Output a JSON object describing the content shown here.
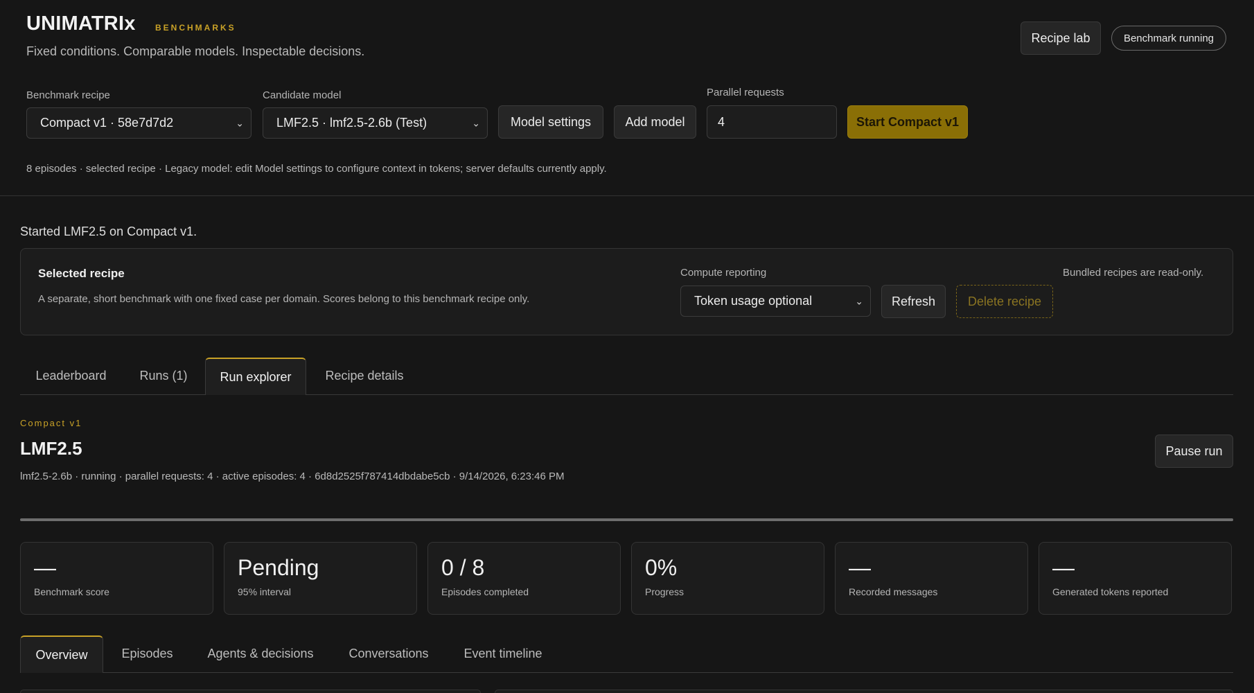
{
  "header": {
    "brand": "UNIMATRIx",
    "brand_tag": "BENCHMARKS",
    "tagline": "Fixed conditions. Comparable models. Inspectable decisions.",
    "recipe_lab_label": "Recipe lab",
    "status_pill": "Benchmark running"
  },
  "controls": {
    "benchmark_recipe_label": "Benchmark recipe",
    "benchmark_recipe_value": "Compact v1 · 58e7d7d2",
    "candidate_model_label": "Candidate model",
    "candidate_model_value": "LMF2.5 · lmf2.5-2.6b (Test)",
    "model_settings_label": "Model settings",
    "add_model_label": "Add model",
    "parallel_requests_label": "Parallel requests",
    "parallel_requests_value": "4",
    "start_label": "Start Compact v1",
    "hint": "8 episodes · selected recipe · Legacy model: edit Model settings to configure context in tokens; server defaults currently apply."
  },
  "status_message": "Started LMF2.5 on Compact v1.",
  "selected_recipe": {
    "title": "Selected recipe",
    "description": "A separate, short benchmark with one fixed case per domain. Scores belong to this benchmark recipe only.",
    "compute_reporting_label": "Compute reporting",
    "compute_reporting_value": "Token usage optional",
    "refresh_label": "Refresh",
    "delete_label": "Delete recipe",
    "readonly_note": "Bundled recipes are read-only."
  },
  "main_tabs": [
    {
      "label": "Leaderboard"
    },
    {
      "label": "Runs (1)"
    },
    {
      "label": "Run explorer",
      "active": true
    },
    {
      "label": "Recipe details"
    }
  ],
  "run": {
    "recipe_tag": "Compact v1",
    "model_title": "LMF2.5",
    "meta": "lmf2.5-2.6b · running · parallel requests: 4 · active episodes: 4 · 6d8d2525f787414dbdabe5cb · 9/14/2026, 6:23:46 PM",
    "pause_label": "Pause run",
    "progress_fraction": 1.0
  },
  "stats": [
    {
      "value": "—",
      "label": "Benchmark score"
    },
    {
      "value": "Pending",
      "label": "95% interval"
    },
    {
      "value": "0 / 8",
      "label": "Episodes completed"
    },
    {
      "value": "0%",
      "label": "Progress"
    },
    {
      "value": "—",
      "label": "Recorded messages"
    },
    {
      "value": "—",
      "label": "Generated tokens reported"
    }
  ],
  "sub_tabs": [
    {
      "label": "Overview",
      "active": true
    },
    {
      "label": "Episodes"
    },
    {
      "label": "Agents & decisions"
    },
    {
      "label": "Conversations"
    },
    {
      "label": "Event timeline"
    }
  ],
  "colors": {
    "accent": "#c9a227",
    "primary_button": "#8a6f06",
    "background": "#161616"
  }
}
